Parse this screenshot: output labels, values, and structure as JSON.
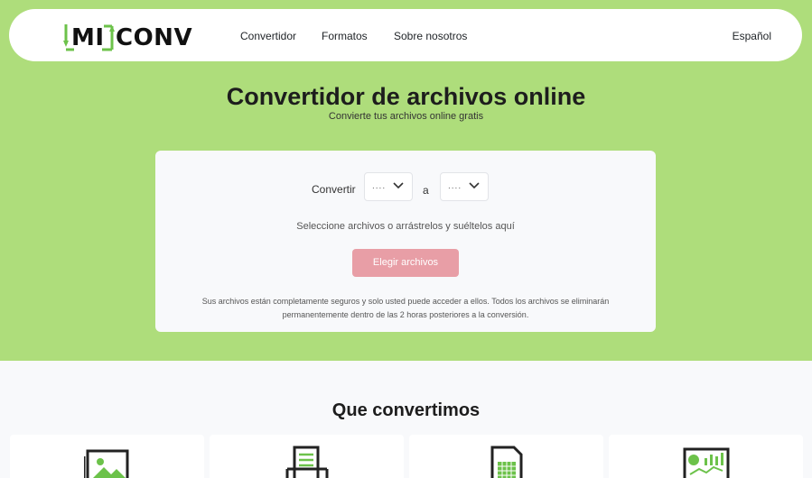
{
  "brand": {
    "logo_left": "MI",
    "logo_right": "CONV",
    "accent": "#6cc24a",
    "hero_bg": "#aedd7b"
  },
  "nav": {
    "links": [
      "Convertidor",
      "Formatos",
      "Sobre nosotros"
    ],
    "language": "Español"
  },
  "hero": {
    "title": "Convertidor de archivos online",
    "subtitle": "Convierte tus archivos online gratis"
  },
  "converter": {
    "convert_label": "Convertir",
    "from_value": "....",
    "to_label": "a",
    "to_value": "....",
    "drop_text": "Seleccione archivos o arrástrelos y suéltelos aquí",
    "choose_button": "Elegir archivos",
    "button_color": "#e89ea6",
    "security_note": "Sus archivos están completamente seguros y solo usted puede acceder a ellos. Todos los archivos se eliminarán permanentemente dentro de las 2 horas posteriores a la conversión."
  },
  "section": {
    "title": "Que convertimos",
    "tiles": [
      {
        "icon": "image-icon"
      },
      {
        "icon": "document-icon"
      },
      {
        "icon": "spreadsheet-icon"
      },
      {
        "icon": "presentation-icon"
      }
    ]
  }
}
